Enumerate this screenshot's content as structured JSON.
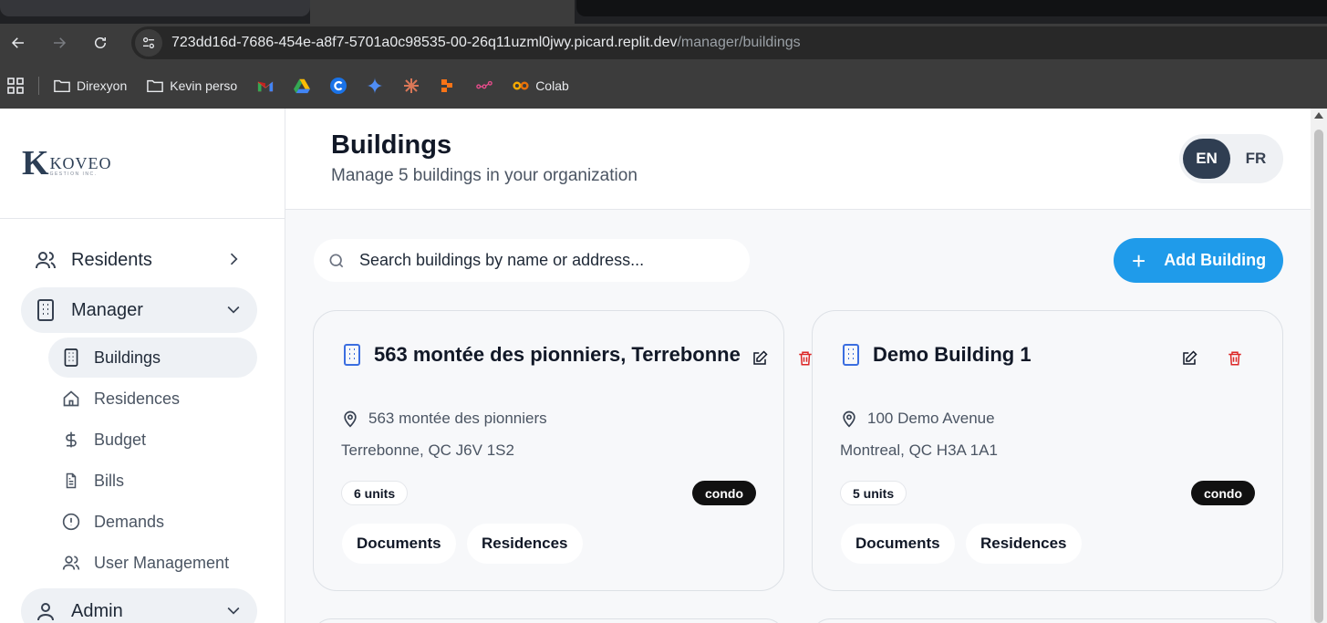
{
  "browser": {
    "address": "723dd16d-7686-454e-a8f7-5701a0c98535-00-26q11uzml0jwy.picard.replit.dev",
    "address_path": "/manager/buildings",
    "bookmarks": [
      {
        "label": "Direxyon",
        "icon": "folder-icon"
      },
      {
        "label": "Kevin perso",
        "icon": "folder-icon"
      },
      {
        "label": "Colab",
        "icon": "colab-icon"
      }
    ]
  },
  "sidebar": {
    "logo": {
      "name": "KOVEO",
      "sub": "GESTION INC."
    },
    "groups": {
      "residents": "Residents",
      "manager": "Manager",
      "admin": "Admin"
    },
    "manager_items": {
      "buildings": "Buildings",
      "residences": "Residences",
      "budget": "Budget",
      "bills": "Bills",
      "demands": "Demands",
      "user_management": "User Management"
    }
  },
  "header": {
    "title": "Buildings",
    "subtitle": "Manage 5 buildings in your organization",
    "lang_en": "EN",
    "lang_fr": "FR"
  },
  "search": {
    "placeholder": "Search buildings by name or address..."
  },
  "add_button": {
    "label": "Add Building"
  },
  "buildings": [
    {
      "name": "563 montée des pionniers, Terrebonne",
      "street": "563 montée des pionniers",
      "city": "Terrebonne, QC J6V 1S2",
      "units": "6 units",
      "type": "condo",
      "documents": "Documents",
      "residences": "Residences"
    },
    {
      "name": "Demo Building 1",
      "street": "100 Demo Avenue",
      "city": "Montreal, QC H3A 1A1",
      "units": "5 units",
      "type": "condo",
      "documents": "Documents",
      "residences": "Residences"
    }
  ],
  "colors": {
    "accent": "#1f9bea",
    "delete": "#dc2626",
    "building_icon": "#3b6ee0",
    "lang_active": "#2f3e52"
  }
}
